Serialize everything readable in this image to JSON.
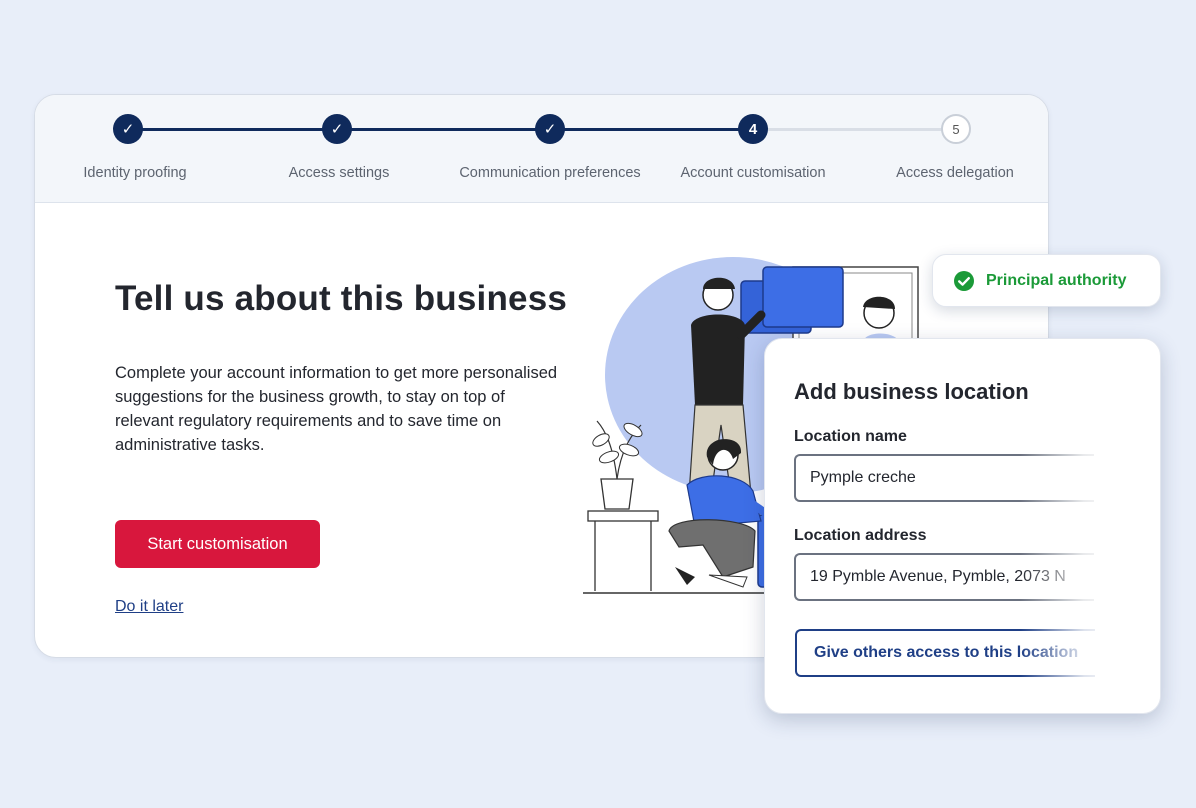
{
  "stepper": {
    "steps": [
      {
        "label": "Identity proofing",
        "state": "done",
        "marker": "✓"
      },
      {
        "label": "Access settings",
        "state": "done",
        "marker": "✓"
      },
      {
        "label": "Communication preferences",
        "state": "done",
        "marker": "✓"
      },
      {
        "label": "Account customisation",
        "state": "current",
        "marker": "4"
      },
      {
        "label": "Access delegation",
        "state": "todo",
        "marker": "5"
      }
    ]
  },
  "main": {
    "title": "Tell us about this business",
    "description": "Complete your account information to get more personalised suggestions for the business growth, to stay on top of relevant regulatory requirements and to save time on administrative tasks.",
    "primary_button": "Start customisation",
    "later_link": "Do it later"
  },
  "badge": {
    "icon": "check-circle-icon",
    "label": "Principal authority",
    "color": "#1b9a38"
  },
  "location_panel": {
    "title": "Add business location",
    "name_label": "Location name",
    "name_value": "Pymple creche",
    "address_label": "Location address",
    "address_value": "19 Pymble Avenue, Pymble, 2073 N",
    "access_button": "Give others access to this location"
  },
  "colors": {
    "navy": "#0f2a5c",
    "primary_red": "#d8173d",
    "link_blue": "#1f3f86",
    "background": "#e8eef9"
  }
}
